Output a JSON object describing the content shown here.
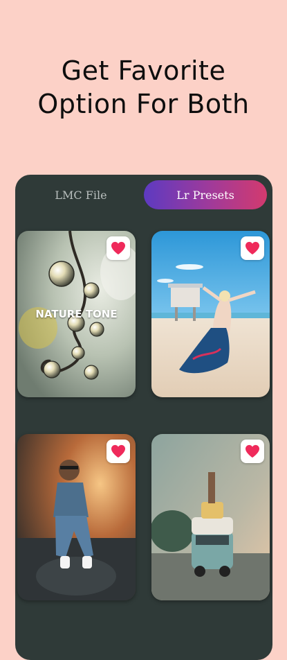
{
  "headline": {
    "line1": "Get Favorite",
    "line2": "Option For Both"
  },
  "tabs": {
    "items": [
      {
        "label": "LMC File",
        "selected": false
      },
      {
        "label": "Lr Presets",
        "selected": true
      }
    ]
  },
  "colors": {
    "background": "#fcd1c7",
    "panel": "#2f3a38",
    "heart": "#ef2a5b",
    "tab_gradient": [
      "#5d3ac1",
      "#d33a6e"
    ]
  },
  "cards": [
    {
      "label": "NATURE TONE",
      "icon": "heart-icon",
      "favorited": true
    },
    {
      "label": "",
      "icon": "heart-icon",
      "favorited": true
    },
    {
      "label": "",
      "icon": "heart-icon",
      "favorited": true
    },
    {
      "label": "",
      "icon": "heart-icon",
      "favorited": true
    }
  ]
}
